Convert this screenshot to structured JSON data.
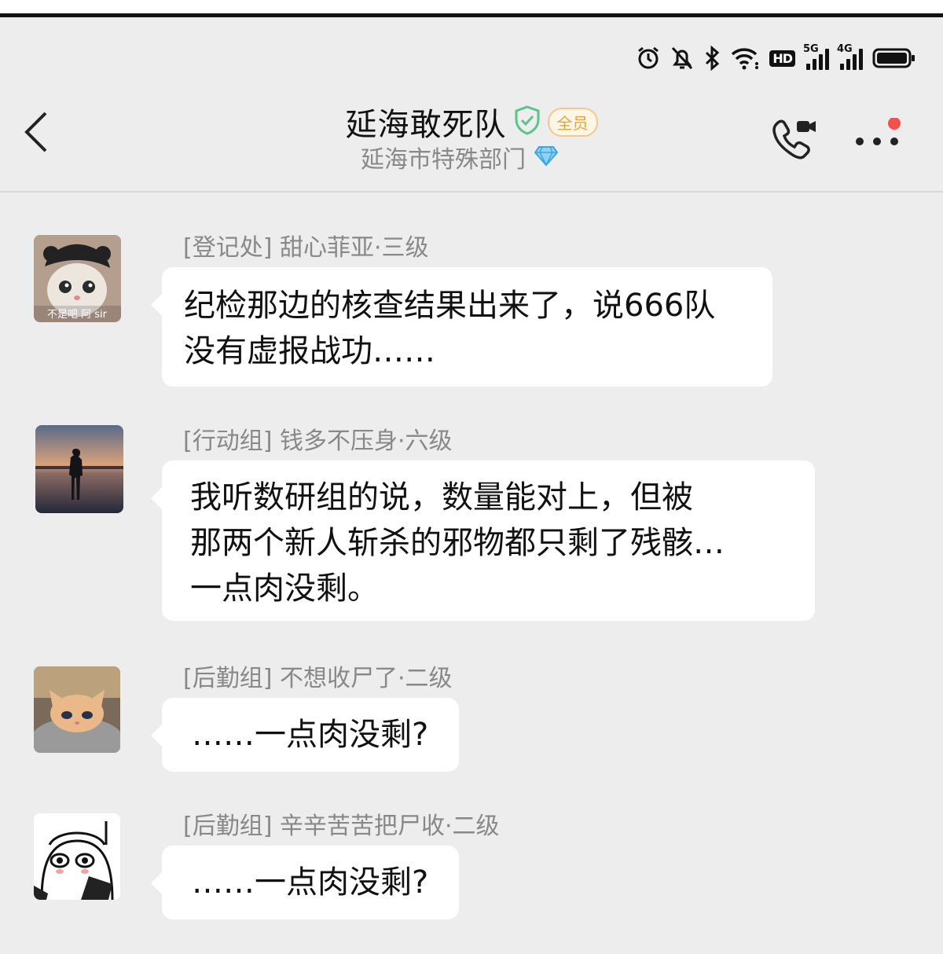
{
  "header": {
    "title": "延海敢死队",
    "member_badge": "全员",
    "subtitle": "延海市特殊部门"
  },
  "status_bar": {
    "hd_label": "HD",
    "signal1": "5G",
    "signal2": "4G"
  },
  "messages": [
    {
      "sender": "[登记处]  甜心菲亚·三级",
      "avatar_caption": "不是吧 阿 sir",
      "lines": [
        "纪检那边的核查结果出来了，说666队",
        "没有虚报战功……"
      ]
    },
    {
      "sender": "[行动组]  钱多不压身·六级",
      "lines": [
        "我听数研组的说，数量能对上，但被",
        "那两个新人斩杀的邪物都只剩了残骸…",
        "一点肉没剩。"
      ]
    },
    {
      "sender": "[后勤组]  不想收尸了·二级",
      "lines": [
        "……一点肉没剩?"
      ]
    },
    {
      "sender": "[后勤组]  辛辛苦苦把尸收·二级",
      "lines": [
        "……一点肉没剩?"
      ]
    }
  ],
  "colors": {
    "background": "#ededed",
    "bubble": "#ffffff",
    "accent_badge": "#e8a33a",
    "dot": "#f0524a"
  }
}
